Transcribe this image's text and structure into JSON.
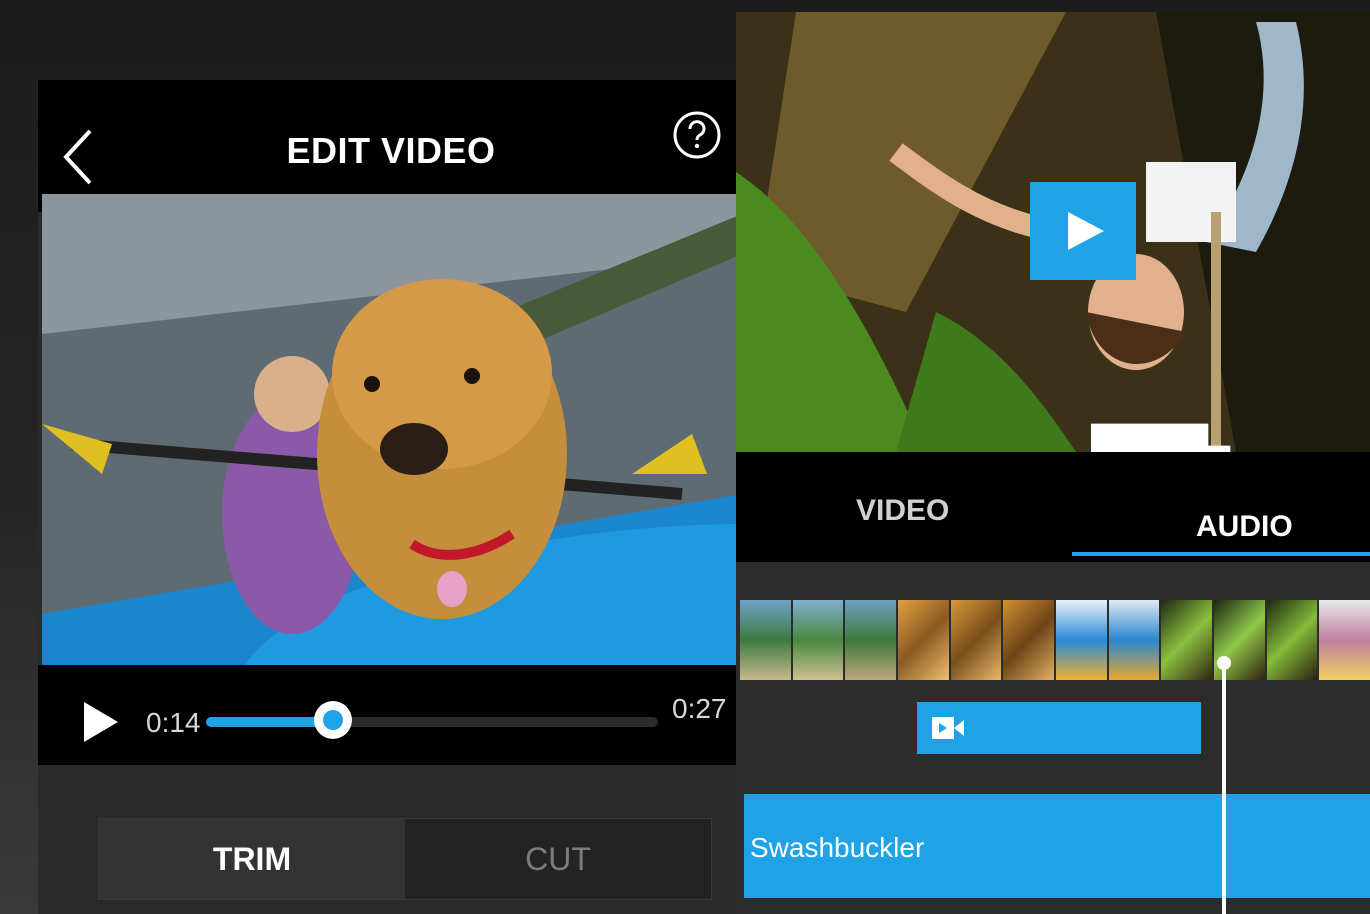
{
  "left": {
    "title": "EDIT VIDEO",
    "player": {
      "current_time": "0:14",
      "total_time": "0:27",
      "progress": 0.28
    },
    "segments": {
      "trim": "TRIM",
      "cut": "CUT",
      "selected": "TRIM"
    }
  },
  "right": {
    "tabs": {
      "video": "VIDEO",
      "audio": "AUDIO",
      "selected": "AUDIO"
    },
    "audio_track": "Swashbuckler"
  },
  "colors": {
    "accent": "#1fa3e6",
    "header_bg": "#000000"
  },
  "icons": [
    "back-icon",
    "help-icon",
    "play-icon",
    "big-play-icon",
    "expand-icon",
    "video-clip-icon"
  ]
}
